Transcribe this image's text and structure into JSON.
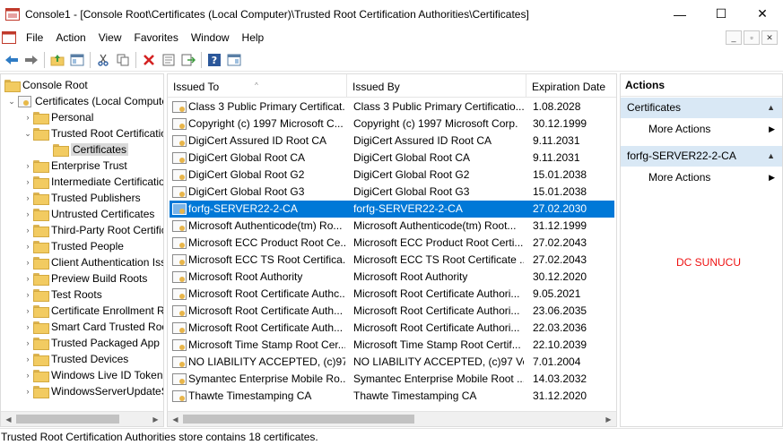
{
  "window": {
    "title": "Console1 - [Console Root\\Certificates (Local Computer)\\Trusted Root Certification Authorities\\Certificates]",
    "minimize": "—",
    "maximize": "☐",
    "close": "✕"
  },
  "menu": {
    "items": [
      "File",
      "Action",
      "View",
      "Favorites",
      "Window",
      "Help"
    ],
    "mdi": {
      "minimize": "_",
      "restore": "▫",
      "close": "✕"
    }
  },
  "toolbar": {
    "icons": [
      "back-arrow-icon",
      "forward-arrow-icon",
      "up-folder-icon",
      "show-hide-tree-icon",
      "cut-icon",
      "copy-icon",
      "delete-icon",
      "properties-icon",
      "export-list-icon",
      "help-icon",
      "show-hide-action-pane-icon"
    ]
  },
  "tree": {
    "root": "Console Root",
    "certificates": "Certificates (Local Computer)",
    "personal": "Personal",
    "trusted_root": "Trusted Root Certification Authorities",
    "certs_leaf": "Certificates",
    "others": [
      "Enterprise Trust",
      "Intermediate Certification Authorities",
      "Trusted Publishers",
      "Untrusted Certificates",
      "Third-Party Root Certification Authorities",
      "Trusted People",
      "Client Authentication Issuers",
      "Preview Build Roots",
      "Test Roots",
      "Certificate Enrollment Requests",
      "Smart Card Trusted Roots",
      "Trusted Packaged App Installation Authorities",
      "Trusted Devices",
      "Windows Live ID Token Issuer",
      "WindowsServerUpdateServices"
    ]
  },
  "list": {
    "columns": [
      "Issued To",
      "Issued By",
      "Expiration Date"
    ],
    "rows": [
      {
        "issued_to": "Class 3 Public Primary Certificat...",
        "issued_by": "Class 3 Public Primary Certificatio...",
        "expires": "1.08.2028"
      },
      {
        "issued_to": "Copyright (c) 1997 Microsoft C...",
        "issued_by": "Copyright (c) 1997 Microsoft Corp.",
        "expires": "30.12.1999"
      },
      {
        "issued_to": "DigiCert Assured ID Root CA",
        "issued_by": "DigiCert Assured ID Root CA",
        "expires": "9.11.2031"
      },
      {
        "issued_to": "DigiCert Global Root CA",
        "issued_by": "DigiCert Global Root CA",
        "expires": "9.11.2031"
      },
      {
        "issued_to": "DigiCert Global Root G2",
        "issued_by": "DigiCert Global Root G2",
        "expires": "15.01.2038"
      },
      {
        "issued_to": "DigiCert Global Root G3",
        "issued_by": "DigiCert Global Root G3",
        "expires": "15.01.2038"
      },
      {
        "issued_to": "forfg-SERVER22-2-CA",
        "issued_by": "forfg-SERVER22-2-CA",
        "expires": "27.02.2030",
        "selected": true
      },
      {
        "issued_to": "Microsoft Authenticode(tm) Ro...",
        "issued_by": "Microsoft Authenticode(tm) Root...",
        "expires": "31.12.1999"
      },
      {
        "issued_to": "Microsoft ECC Product Root Ce...",
        "issued_by": "Microsoft ECC Product Root Certi...",
        "expires": "27.02.2043"
      },
      {
        "issued_to": "Microsoft ECC TS Root Certifica...",
        "issued_by": "Microsoft ECC TS Root Certificate ...",
        "expires": "27.02.2043"
      },
      {
        "issued_to": "Microsoft Root Authority",
        "issued_by": "Microsoft Root Authority",
        "expires": "30.12.2020"
      },
      {
        "issued_to": "Microsoft Root Certificate Authc...",
        "issued_by": "Microsoft Root Certificate Authori...",
        "expires": "9.05.2021"
      },
      {
        "issued_to": "Microsoft Root Certificate Auth...",
        "issued_by": "Microsoft Root Certificate Authori...",
        "expires": "23.06.2035"
      },
      {
        "issued_to": "Microsoft Root Certificate Auth...",
        "issued_by": "Microsoft Root Certificate Authori...",
        "expires": "22.03.2036"
      },
      {
        "issued_to": "Microsoft Time Stamp Root Cer...",
        "issued_by": "Microsoft Time Stamp Root Certif...",
        "expires": "22.10.2039"
      },
      {
        "issued_to": "NO LIABILITY ACCEPTED, (c)97 ...",
        "issued_by": "NO LIABILITY ACCEPTED, (c)97 Ve...",
        "expires": "7.01.2004"
      },
      {
        "issued_to": "Symantec Enterprise Mobile Ro...",
        "issued_by": "Symantec Enterprise Mobile Root ...",
        "expires": "14.03.2032"
      },
      {
        "issued_to": "Thawte Timestamping CA",
        "issued_by": "Thawte Timestamping CA",
        "expires": "31.12.2020"
      }
    ]
  },
  "actions": {
    "header": "Actions",
    "section1": "Certificates",
    "section1_more": "More Actions",
    "section2": "forfg-SERVER22-2-CA",
    "section2_more": "More Actions"
  },
  "annotation": "DC SUNUCU",
  "status": "Trusted Root Certification Authorities store contains 18 certificates.",
  "colors": {
    "selection": "#0078d7",
    "action_section": "#d9e8f5",
    "annotation": "#ee1111"
  }
}
